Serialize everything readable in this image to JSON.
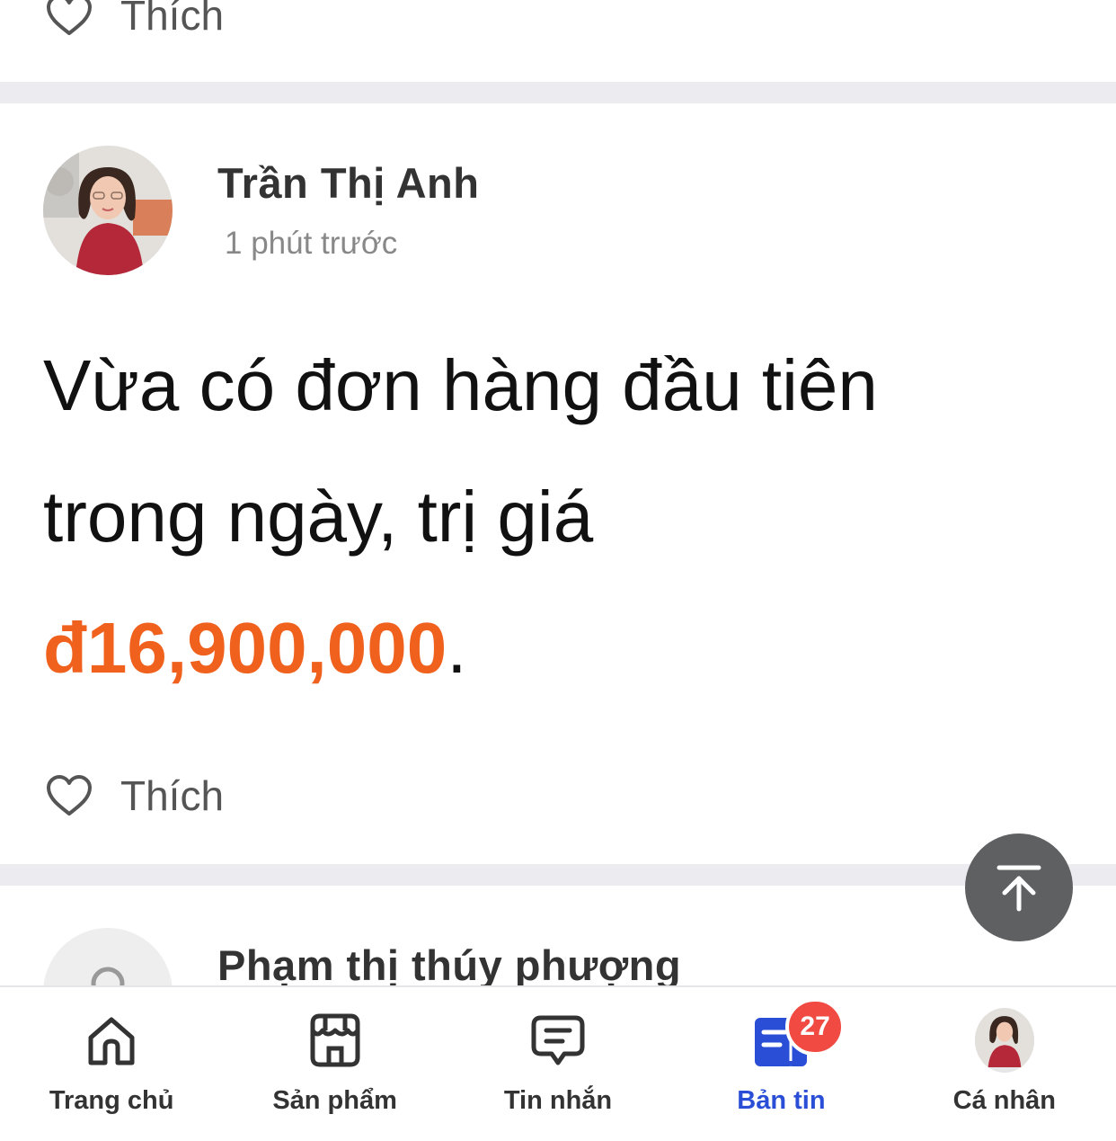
{
  "feed": {
    "previous_post": {
      "like_label": "Thích"
    },
    "post": {
      "author": "Trần Thị Anh",
      "time": "1 phút trước",
      "text_line_1": "Vừa có đơn hàng đầu tiên",
      "text_line_2": "trong ngày, trị giá",
      "amount": "đ16,900,000",
      "period": ".",
      "like_label": "Thích"
    },
    "next_post": {
      "author": "Phạm thị thúy phượng"
    }
  },
  "bottom_nav": {
    "items": [
      {
        "label": "Trang chủ",
        "icon": "home-icon"
      },
      {
        "label": "Sản phẩm",
        "icon": "store-icon"
      },
      {
        "label": "Tin nhắn",
        "icon": "message-icon"
      },
      {
        "label": "Bản tin",
        "icon": "news-icon",
        "badge": "27",
        "active": true
      },
      {
        "label": "Cá nhân",
        "icon": "profile-avatar"
      }
    ]
  },
  "colors": {
    "accent": "#2a4fd6",
    "amount": "#f0611e",
    "badge": "#f04a42",
    "divider": "#ececf0"
  }
}
